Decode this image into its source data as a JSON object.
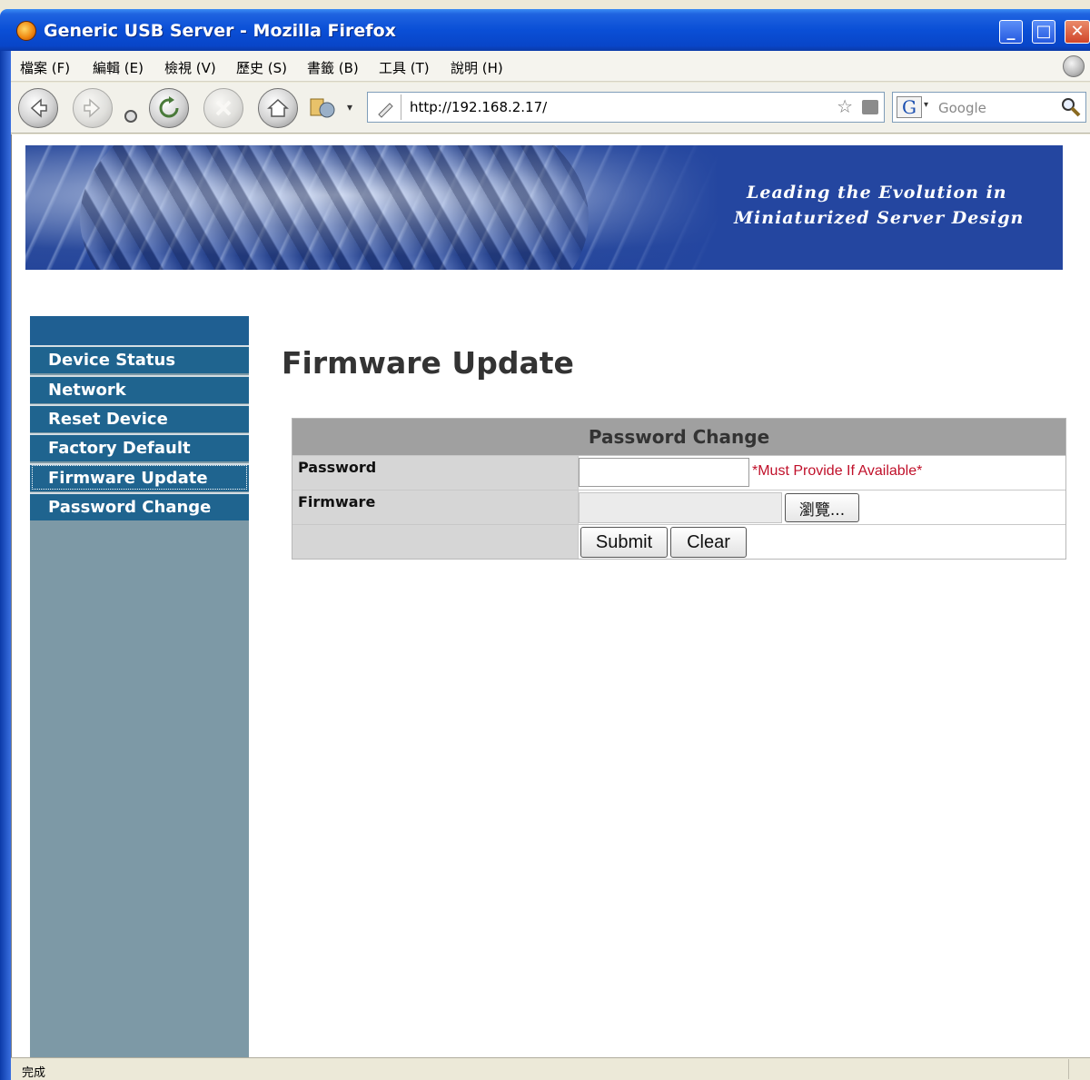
{
  "window": {
    "title": "Generic USB Server - Mozilla Firefox",
    "minimize_glyph": "_",
    "maximize_glyph": "□",
    "close_glyph": "✕"
  },
  "menu": {
    "items": [
      "檔案 (F)",
      "編輯 (E)",
      "檢視 (V)",
      "歷史 (S)",
      "書籤 (B)",
      "工具 (T)",
      "說明 (H)"
    ]
  },
  "toolbar": {
    "url": "http://192.168.2.17/",
    "search_placeholder": "Google",
    "search_engine_glyph": "G",
    "star_glyph": "☆",
    "dropdown_glyph": "▾"
  },
  "banner": {
    "tagline_line1": "Leading the Evolution in",
    "tagline_line2": "Miniaturized Server Design"
  },
  "sidebar": {
    "items": [
      {
        "label": "Device Status"
      },
      {
        "label": "Network"
      },
      {
        "label": "Reset Device"
      },
      {
        "label": "Factory Default"
      },
      {
        "label": "Firmware Update",
        "active": true
      },
      {
        "label": "Password Change"
      }
    ]
  },
  "main": {
    "title": "Firmware Update",
    "form": {
      "header": "Password Change",
      "password_label": "Password",
      "password_value": "",
      "password_note": "*Must Provide If Available*",
      "firmware_label": "Firmware",
      "browse_label": "瀏覽...",
      "submit_label": "Submit",
      "clear_label": "Clear"
    }
  },
  "status": {
    "text": "完成"
  }
}
